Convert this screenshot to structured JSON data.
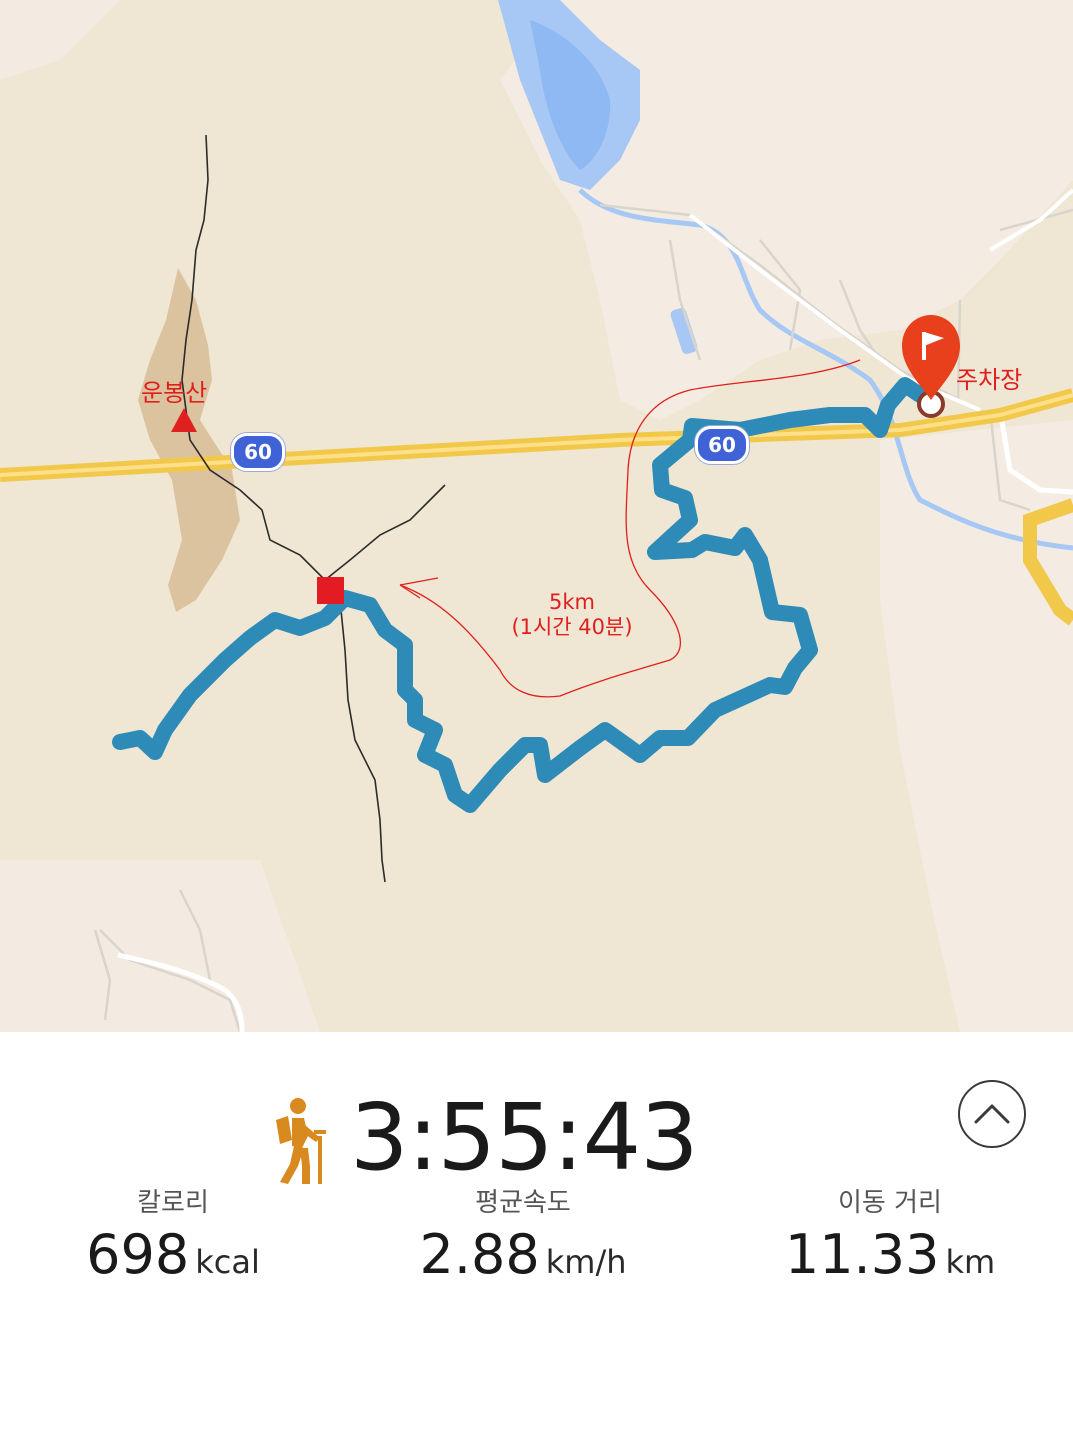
{
  "map": {
    "peak_label": "운봉산",
    "parking_label": "주차장",
    "route_distance": "5km",
    "route_duration": "(1시간 40분)",
    "road_badges": [
      "60",
      "60"
    ],
    "colors": {
      "land": "#efe7d3",
      "water": "#a7c8f5",
      "track": "#2e8bb8",
      "highway": "#f2c84b",
      "annotation": "#e0201e",
      "pin": "#e8401c"
    },
    "icons": {
      "summit": "red-triangle-icon",
      "waypoint": "red-square-icon",
      "destination": "flag-pin-icon"
    }
  },
  "workout": {
    "activity_icon": "hiking-icon",
    "elapsed_time": "3:55:43",
    "collapse_icon": "chevron-up-icon",
    "stats": {
      "calories": {
        "label": "칼로리",
        "value": "698",
        "unit": "kcal"
      },
      "avg_speed": {
        "label": "평균속도",
        "value": "2.88",
        "unit": "km/h"
      },
      "distance": {
        "label": "이동 거리",
        "value": "11.33",
        "unit": "km"
      }
    }
  }
}
